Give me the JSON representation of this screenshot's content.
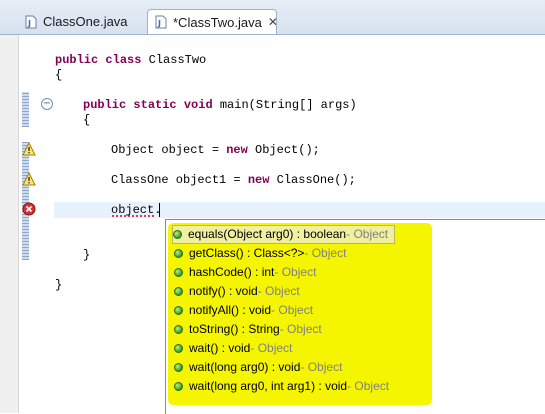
{
  "tabs": [
    {
      "label": "ClassOne.java",
      "active": false
    },
    {
      "label": "*ClassTwo.java",
      "active": true,
      "close": "✕"
    }
  ],
  "code_lines": [
    [
      {
        "t": "public",
        "k": true
      },
      {
        "t": " "
      },
      {
        "t": "class",
        "k": true
      },
      {
        "t": " ClassTwo"
      }
    ],
    [
      {
        "t": "{"
      }
    ],
    [
      {
        "t": "public",
        "k": true
      },
      {
        "t": " "
      },
      {
        "t": "static",
        "k": true
      },
      {
        "t": " "
      },
      {
        "t": "void",
        "k": true
      },
      {
        "t": " main(String[] args)"
      }
    ],
    [
      {
        "t": "{"
      }
    ],
    [
      {
        "t": "Object object = "
      },
      {
        "t": "new",
        "k": true
      },
      {
        "t": " Object();"
      }
    ],
    [
      {
        "t": "ClassOne object1 = "
      },
      {
        "t": "new",
        "k": true
      },
      {
        "t": " ClassOne();"
      }
    ],
    [
      {
        "t": "object."
      }
    ],
    [
      {
        "t": "}"
      }
    ],
    [
      {
        "t": "}"
      }
    ]
  ],
  "proposals": [
    {
      "sig": "equals(Object arg0) : boolean",
      "type": " - Object",
      "selected": true
    },
    {
      "sig": "getClass() : Class<?>",
      "type": " - Object"
    },
    {
      "sig": "hashCode() : int",
      "type": " - Object"
    },
    {
      "sig": "notify() : void",
      "type": " - Object"
    },
    {
      "sig": "notifyAll() : void",
      "type": " - Object"
    },
    {
      "sig": "toString() : String",
      "type": " - Object"
    },
    {
      "sig": "wait() : void",
      "type": " - Object"
    },
    {
      "sig": "wait(long arg0) : void",
      "type": " - Object"
    },
    {
      "sig": "wait(long arg0, int arg1) : void",
      "type": " - Object"
    }
  ],
  "fold_symbol": "−",
  "colors": {
    "keyword": "#7f0055",
    "highlight": "#f5f500",
    "error": "#d93030",
    "warning": "#f0c000"
  }
}
